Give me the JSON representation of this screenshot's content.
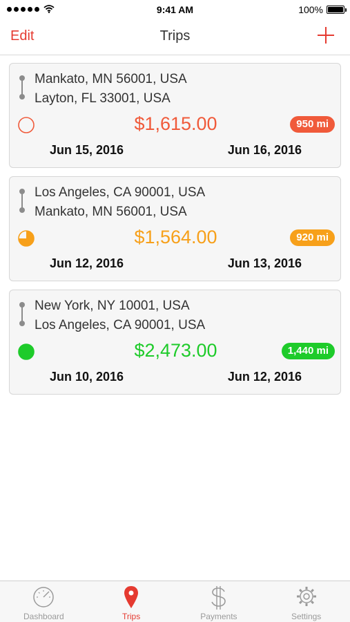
{
  "status_bar": {
    "time": "9:41 AM",
    "battery": "100%",
    "wifi_icon": "wifi-icon",
    "signal_icon": "signal-dots-icon"
  },
  "nav": {
    "edit_label": "Edit",
    "title": "Trips",
    "add_icon": "plus-icon"
  },
  "trips": [
    {
      "from": "Mankato, MN 56001, USA",
      "to": "Layton, FL 33001, USA",
      "amount": "$1,615.00",
      "miles": "950 mi",
      "start_date": "Jun 15, 2016",
      "end_date": "Jun 16, 2016",
      "progress": 0,
      "color": "#f05a3a"
    },
    {
      "from": "Los Angeles, CA 90001, USA",
      "to": "Mankato, MN 56001, USA",
      "amount": "$1,564.00",
      "miles": "920 mi",
      "start_date": "Jun 12, 2016",
      "end_date": "Jun 13, 2016",
      "progress": 0.75,
      "color": "#f7a01a"
    },
    {
      "from": "New York, NY 10001, USA",
      "to": "Los Angeles, CA 90001, USA",
      "amount": "$2,473.00",
      "miles": "1,440 mi",
      "start_date": "Jun 10, 2016",
      "end_date": "Jun 12, 2016",
      "progress": 1,
      "color": "#1ecb2a"
    }
  ],
  "tabs": [
    {
      "label": "Dashboard",
      "icon": "speedometer-icon",
      "active": false
    },
    {
      "label": "Trips",
      "icon": "map-pin-icon",
      "active": true
    },
    {
      "label": "Payments",
      "icon": "dollar-icon",
      "active": false
    },
    {
      "label": "Settings",
      "icon": "gear-icon",
      "active": false
    }
  ],
  "colors": {
    "accent": "#e53a30",
    "inactive": "#9a9a9a"
  }
}
